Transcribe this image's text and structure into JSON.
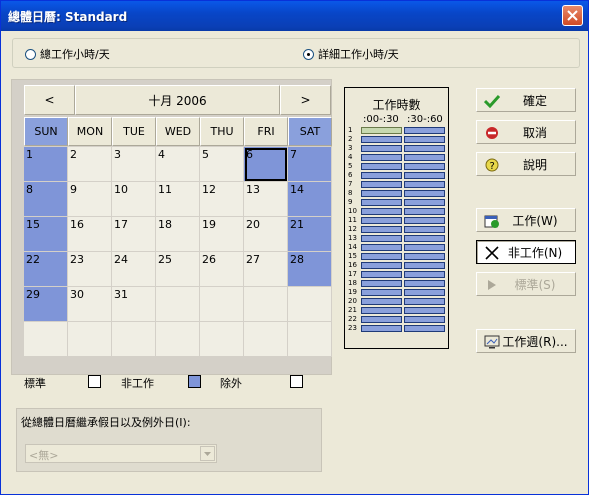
{
  "window": {
    "title": "總體日曆: Standard"
  },
  "mode": {
    "options": [
      {
        "label": "總工作小時/天",
        "checked": false
      },
      {
        "label": "詳細工作小時/天",
        "checked": true
      }
    ]
  },
  "calendar": {
    "prev_label": "<",
    "next_label": ">",
    "month_title": "十月 2006",
    "weekdays": [
      "SUN",
      "MON",
      "TUE",
      "WED",
      "THU",
      "FRI",
      "SAT"
    ],
    "weeks": [
      [
        {
          "day": "1",
          "exception": true
        },
        {
          "day": "2",
          "exception": false
        },
        {
          "day": "3",
          "exception": false
        },
        {
          "day": "4",
          "exception": false
        },
        {
          "day": "5",
          "exception": false
        },
        {
          "day": "6",
          "exception": true,
          "selected": true
        },
        {
          "day": "7",
          "exception": true
        }
      ],
      [
        {
          "day": "8",
          "exception": true
        },
        {
          "day": "9",
          "exception": false
        },
        {
          "day": "10",
          "exception": false
        },
        {
          "day": "11",
          "exception": false
        },
        {
          "day": "12",
          "exception": false
        },
        {
          "day": "13",
          "exception": false
        },
        {
          "day": "14",
          "exception": true
        }
      ],
      [
        {
          "day": "15",
          "exception": true
        },
        {
          "day": "16",
          "exception": false
        },
        {
          "day": "17",
          "exception": false
        },
        {
          "day": "18",
          "exception": false
        },
        {
          "day": "19",
          "exception": false
        },
        {
          "day": "20",
          "exception": false
        },
        {
          "day": "21",
          "exception": true
        }
      ],
      [
        {
          "day": "22",
          "exception": true
        },
        {
          "day": "23",
          "exception": false
        },
        {
          "day": "24",
          "exception": false
        },
        {
          "day": "25",
          "exception": false
        },
        {
          "day": "26",
          "exception": false
        },
        {
          "day": "27",
          "exception": false
        },
        {
          "day": "28",
          "exception": true
        }
      ],
      [
        {
          "day": "29",
          "exception": true
        },
        {
          "day": "30",
          "exception": false
        },
        {
          "day": "31",
          "exception": false
        },
        {
          "day": "",
          "exception": false
        },
        {
          "day": "",
          "exception": false
        },
        {
          "day": "",
          "exception": false
        },
        {
          "day": "",
          "exception": false
        }
      ],
      [
        {
          "day": "",
          "exception": false
        },
        {
          "day": "",
          "exception": false
        },
        {
          "day": "",
          "exception": false
        },
        {
          "day": "",
          "exception": false
        },
        {
          "day": "",
          "exception": false
        },
        {
          "day": "",
          "exception": false
        },
        {
          "day": "",
          "exception": false
        }
      ]
    ]
  },
  "legend": {
    "standard_label": "標準",
    "nonworking_label": "非工作",
    "exception_label": "除外",
    "colors": {
      "standard": "#ffffff",
      "nonworking": "#7f95d8",
      "exception": "#ffffff"
    }
  },
  "inherit": {
    "label": "從總體日曆繼承假日以及例外日(I):",
    "value": "<無>"
  },
  "hours_panel": {
    "title": "工作時數",
    "col1": ":00-:30",
    "col2": ":30-:60",
    "rows": [
      "1",
      "2",
      "3",
      "4",
      "5",
      "6",
      "7",
      "8",
      "9",
      "10",
      "11",
      "12",
      "13",
      "14",
      "15",
      "16",
      "17",
      "18",
      "19",
      "20",
      "21",
      "22",
      "23"
    ]
  },
  "buttons": {
    "ok": "確定",
    "cancel": "取消",
    "help": "說明",
    "working": "工作(W)",
    "nonworking": "非工作(N)",
    "standard": "標準(S)",
    "work_week": "工作週(R)..."
  },
  "colors": {
    "accent": "#0a4ed8",
    "exception_fill": "#7f95d8",
    "bar_fill": "#8aa0dc"
  }
}
